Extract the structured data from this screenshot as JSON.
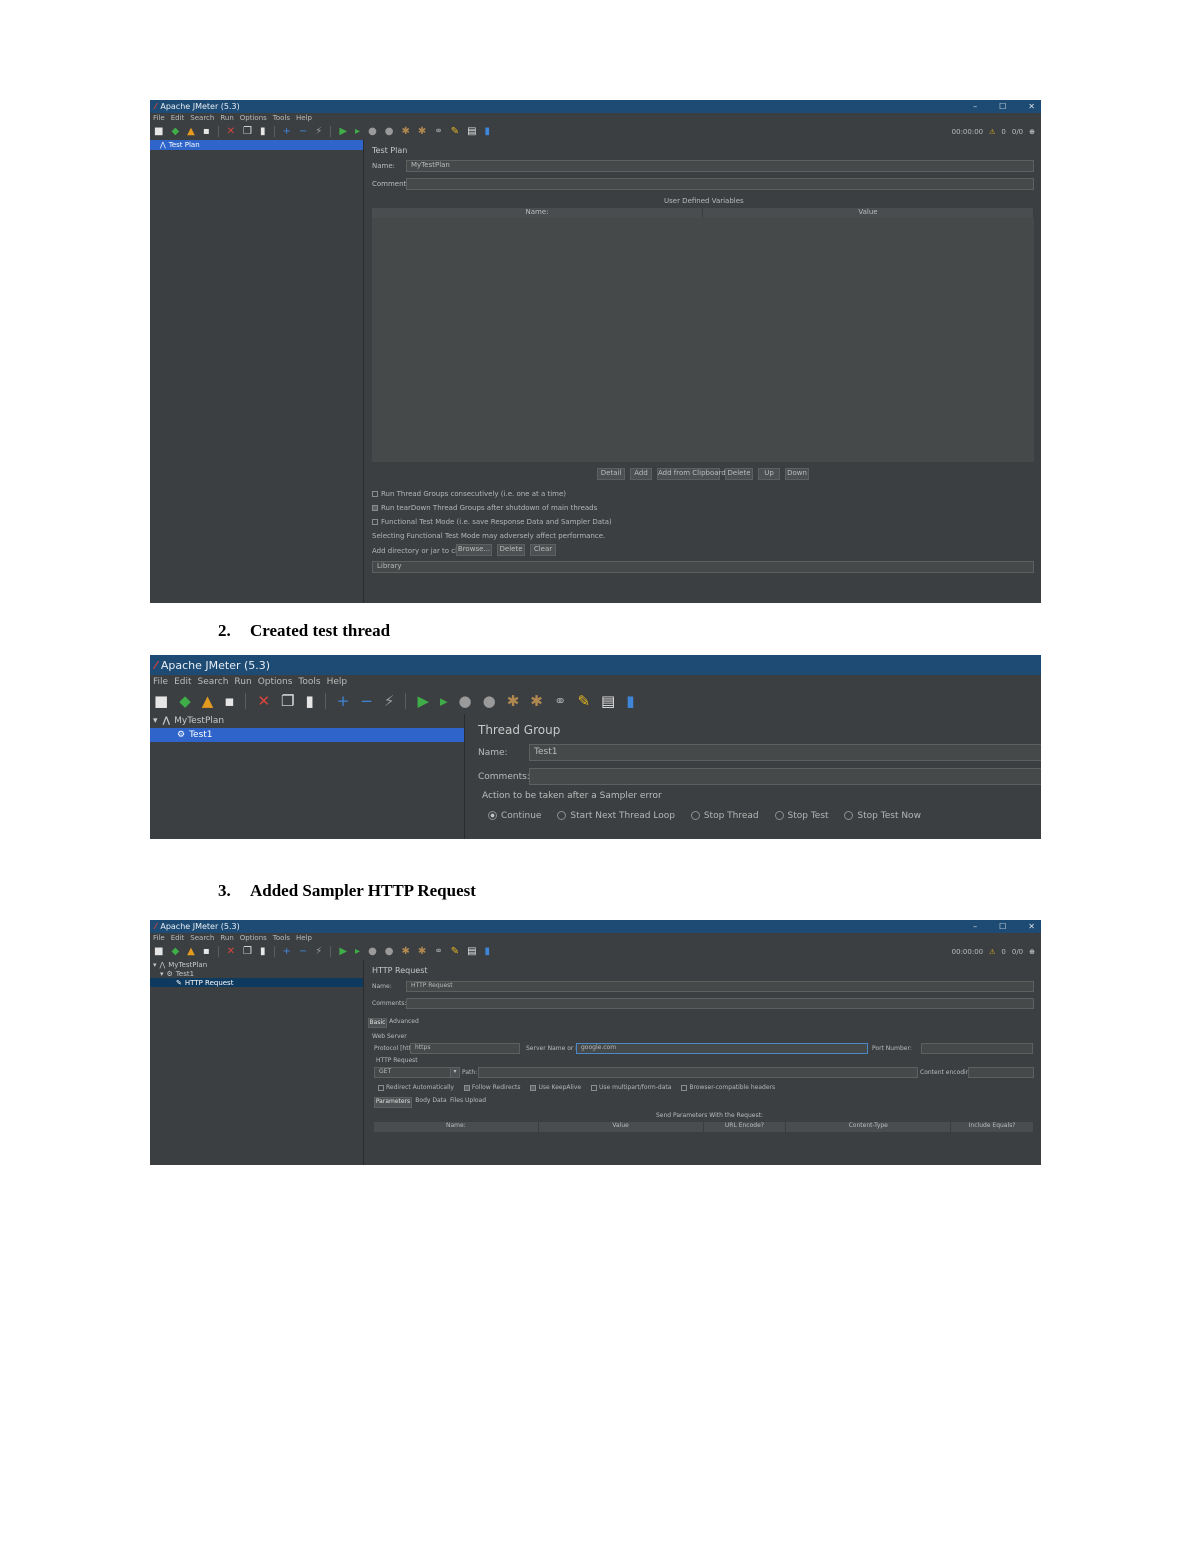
{
  "doc": {
    "step2": {
      "num": "2.",
      "text": "Created test thread"
    },
    "step3": {
      "num": "3.",
      "text": "Added Sampler HTTP Request"
    }
  },
  "app": {
    "title": "Apache JMeter (5.3)",
    "menu": [
      "File",
      "Edit",
      "Search",
      "Run",
      "Options",
      "Tools",
      "Help"
    ],
    "window_controls": {
      "minimize": "–",
      "maximize": "☐",
      "close": "✕"
    },
    "toolbar_right": {
      "time": "00:00:00",
      "warn_count": "0",
      "threads": "0/0"
    }
  },
  "shot1": {
    "tree": [
      {
        "label": "Test Plan",
        "selected": true
      }
    ],
    "panel_title": "Test Plan",
    "name_label": "Name:",
    "name_value": "MyTestPlan",
    "comments_label": "Comments:",
    "udv_title": "User Defined Variables",
    "table_headers": [
      "Name:",
      "Value"
    ],
    "table_buttons": [
      "Detail",
      "Add",
      "Add from Clipboard",
      "Delete",
      "Up",
      "Down"
    ],
    "options": [
      "Run Thread Groups consecutively (i.e. one at a time)",
      "Run tearDown Thread Groups after shutdown of main threads",
      "Functional Test Mode (i.e. save Response Data and Sampler Data)",
      "Selecting Functional Test Mode may adversely affect performance."
    ],
    "classpath_label": "Add directory or jar to classpath",
    "classpath_buttons": [
      "Browse...",
      "Delete",
      "Clear"
    ],
    "library_label": "Library"
  },
  "shot2": {
    "tree": [
      {
        "label": "MyTestPlan",
        "selected": false,
        "level": 0
      },
      {
        "label": "Test1",
        "selected": true,
        "level": 1
      }
    ],
    "panel_title": "Thread Group",
    "name_label": "Name:",
    "name_value": "Test1",
    "comments_label": "Comments:",
    "action_title": "Action to be taken after a Sampler error",
    "radios": [
      {
        "label": "Continue",
        "selected": true
      },
      {
        "label": "Start Next Thread Loop",
        "selected": false
      },
      {
        "label": "Stop Thread",
        "selected": false
      },
      {
        "label": "Stop Test",
        "selected": false
      },
      {
        "label": "Stop Test Now",
        "selected": false
      }
    ]
  },
  "shot3": {
    "tree": [
      {
        "label": "MyTestPlan",
        "selected": false,
        "level": 0
      },
      {
        "label": "Test1",
        "selected": false,
        "level": 1
      },
      {
        "label": "HTTP Request",
        "selected": true,
        "level": 2
      }
    ],
    "panel_title": "HTTP Request",
    "name_label": "Name:",
    "name_value": "HTTP Request",
    "comments_label": "Comments:",
    "tabs": [
      {
        "label": "Basic",
        "active": true
      },
      {
        "label": "Advanced",
        "active": false
      }
    ],
    "web_server_label": "Web Server",
    "protocol_label": "Protocol [http]:",
    "protocol_value": "https",
    "server_label": "Server Name or IP:",
    "server_value": "google.com",
    "port_label": "Port Number:",
    "http_request_label": "HTTP Request",
    "method_value": "GET",
    "path_label": "Path:",
    "encoding_label": "Content encoding:",
    "checkboxes": [
      {
        "label": "Redirect Automatically",
        "checked": false
      },
      {
        "label": "Follow Redirects",
        "checked": true
      },
      {
        "label": "Use KeepAlive",
        "checked": true
      },
      {
        "label": "Use multipart/form-data",
        "checked": false
      },
      {
        "label": "Browser-compatible headers",
        "checked": false
      }
    ],
    "sub_tabs": [
      "Parameters",
      "Body Data",
      "Files Upload"
    ],
    "params_title": "Send Parameters With the Request:",
    "param_headers": [
      "Name:",
      "Value",
      "URL Encode?",
      "Content-Type",
      "Include Equals?"
    ]
  }
}
